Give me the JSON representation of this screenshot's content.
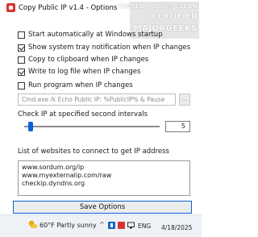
{
  "window": {
    "title": "Copy Public IP v1.4 - Options",
    "watermark_lines": [
      "TESTED • 100% CLEAN",
      "CERTIFIED",
      "MAJORGEEKS"
    ]
  },
  "options": [
    {
      "label": "Start automatically at Windows startup",
      "checked": false
    },
    {
      "label": "Show system tray notification when IP changes",
      "checked": true
    },
    {
      "label": "Copy to clipboard when IP changes",
      "checked": false
    },
    {
      "label": "Write to log file when IP changes",
      "checked": true
    }
  ],
  "run_program": {
    "label": "Run program when IP changes",
    "checked": false,
    "command": "Cmd.exe /k Echo Public IP: %PublicIP% & Pause",
    "browse_label": "..."
  },
  "interval": {
    "label": "Check IP at specified second intervals",
    "value": "5",
    "slider_fraction": 0.03
  },
  "websites": {
    "label": "List of websites to connect to get IP address",
    "items": [
      "www.sordum.org/ip",
      "www.myexternalip.com/raw",
      "checkip.dyndns.org"
    ]
  },
  "save_button": "Save Options",
  "taskbar": {
    "weather": "60°F  Partly sunny",
    "tray_chevron": "^",
    "lang": "ENG",
    "clock_date": "4/18/2025",
    "colors": {
      "accent": "#0a5fd8",
      "brand": "#d8342c"
    }
  }
}
